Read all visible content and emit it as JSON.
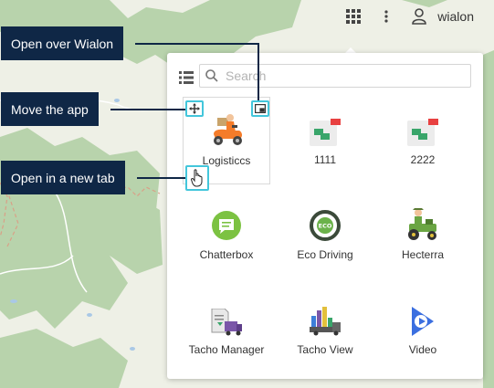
{
  "topbar": {
    "username": "wialon",
    "icons": [
      "apps-grid-icon",
      "more-vert-icon",
      "user-icon"
    ]
  },
  "panel": {
    "search_placeholder": "Search",
    "apps": [
      {
        "label": "Logisticcs",
        "icon": "logistics-icon"
      },
      {
        "label": "1111",
        "icon": "app-default-icon"
      },
      {
        "label": "2222",
        "icon": "app-default-icon"
      },
      {
        "label": "Chatterbox",
        "icon": "chatterbox-icon"
      },
      {
        "label": "Eco Driving",
        "icon": "eco-driving-icon"
      },
      {
        "label": "Hecterra",
        "icon": "hecterra-icon"
      },
      {
        "label": "Tacho Manager",
        "icon": "tacho-manager-icon"
      },
      {
        "label": "Tacho View",
        "icon": "tacho-view-icon"
      },
      {
        "label": "Video",
        "icon": "video-icon"
      }
    ]
  },
  "callouts": {
    "open_over": "Open over Wialon",
    "move": "Move the app",
    "new_tab": "Open in a new tab"
  },
  "colors": {
    "accent": "#43c6db",
    "callout_bg": "#0f2746",
    "map_forest": "#b8d3ac",
    "map_bg": "#eef0e6"
  }
}
